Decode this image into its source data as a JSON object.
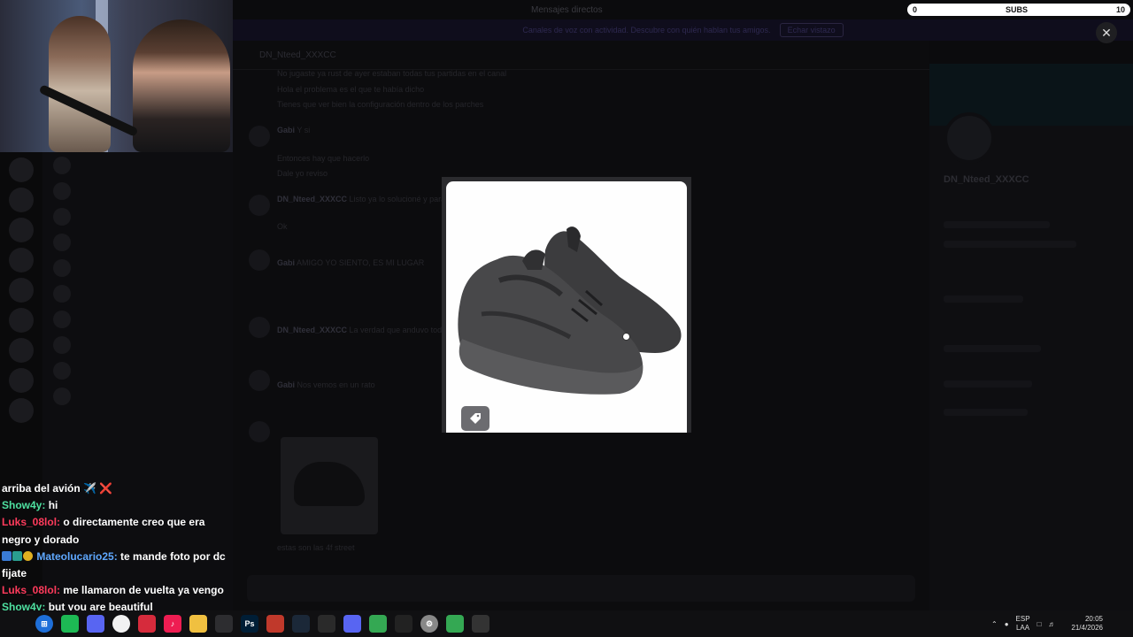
{
  "subs": {
    "left_value": "0",
    "label": "SUBS",
    "right_value": "10",
    "progress": 0.0
  },
  "window": {
    "title": "Mensajes directos"
  },
  "banner": {
    "text": "Canales de voz con actividad. Descubre con quién hablan tus amigos.",
    "button": "Echar vistazo"
  },
  "chat": {
    "header": "DN_Nteed_XXXCC",
    "messages": [
      {
        "author": "",
        "text": "No jugaste ya rust de ayer estaban todas tus partidas en el canal"
      },
      {
        "author": "",
        "text": "Hola el problema es el que te había dicho"
      },
      {
        "author": "",
        "text": "Tienes que ver bien la configuración dentro de los parches"
      },
      {
        "author": "Gabi",
        "text": "Y si"
      },
      {
        "author": "",
        "text": "Entonces hay que hacerlo"
      },
      {
        "author": "",
        "text": "Dale yo reviso"
      },
      {
        "author": "DN_Nteed_XXXCC",
        "text": "Listo ya lo solucioné y para la próxima"
      },
      {
        "author": "",
        "text": "Ok"
      },
      {
        "author": "Gabi",
        "text": "AMIGO YO SIENTO, ES MI LUGAR"
      },
      {
        "author": "DN_Nteed_XXXCC",
        "text": "La verdad que anduvo todo bien"
      },
      {
        "author": "Gabi",
        "text": "Nos vemos en un rato"
      },
      {
        "author": "DN_Nteed_XXXCC",
        "text": "estas son las 4f street"
      }
    ]
  },
  "profile": {
    "name": "DN_Nteed_XXXCC"
  },
  "stream_chat": [
    {
      "user": "",
      "text": "arriba del avión ✈️ ❌"
    },
    {
      "user": "Show4y:",
      "text": "hi"
    },
    {
      "user": "Luks_08lol:",
      "text": "o directamente creo que era negro y dorado"
    },
    {
      "user": "Mateolucario25:",
      "text": "te mande foto por dc fijate"
    },
    {
      "user": "Luks_08lol:",
      "text": "me llamaron de vuelta ya vengo"
    },
    {
      "user": "Show4y:",
      "text": "but you are beautiful"
    }
  ],
  "taskbar": {
    "icons": [
      "start-icon",
      "spotify-icon",
      "discord-icon",
      "notes-icon",
      "opera-icon",
      "tiktok-icon",
      "folder-icon",
      "app-icon",
      "photoshop-icon",
      "red-app-icon",
      "steam-icon",
      "epic-icon",
      "discord-icon-2",
      "chrome-icon",
      "obs-icon",
      "settings-icon",
      "chrome-icon-2",
      "github-icon"
    ],
    "lang_top": "ESP",
    "lang_bottom": "LAA",
    "time": "20:05",
    "date": "21/4/2026"
  },
  "colors": {
    "accent": "#5865f2",
    "backdrop": "#0b0b0d"
  }
}
